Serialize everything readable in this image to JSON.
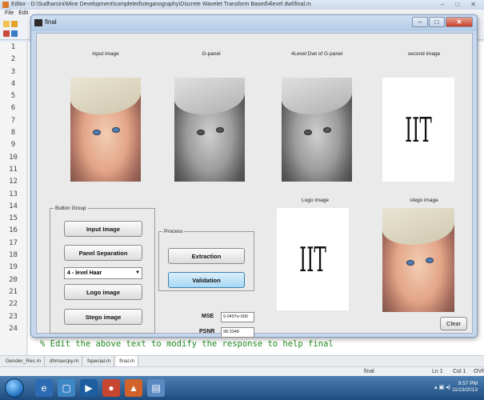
{
  "editor": {
    "title": "Editor - D:\\Sudharsini\\Mine Development\\completed\\steganography\\Discrete Wavelet Transform Based\\4level dwt\\final.m",
    "menu": [
      "File",
      "Edit"
    ],
    "line_numbers": [
      "1",
      "2",
      "3",
      "4",
      "5",
      "6",
      "7",
      "8",
      "9",
      "10",
      "11",
      "12",
      "13",
      "14",
      "15",
      "16",
      "17",
      "18",
      "19",
      "20",
      "21",
      "22",
      "23",
      "24"
    ],
    "code_comment": "% Edit the above text to modify the response to help final",
    "file_tabs": [
      "Gender_Rec.m",
      "dhmaxcpy.m",
      "fspecial.m",
      "final.m"
    ],
    "active_tab": "final.m",
    "status": {
      "name": "final",
      "ln": "Ln 1",
      "col": "Col 1",
      "ovr": "OVR"
    }
  },
  "figure": {
    "title": "final",
    "controls": {
      "minimize": "–",
      "maximize": "□",
      "close": "✕"
    },
    "images": {
      "input": "input image",
      "gpanel": "G-panel",
      "dwt": "4Level Dwt of G-panel",
      "second": "second image",
      "logo": "Logo image",
      "stego": "stego image"
    },
    "logo_text": "IIT",
    "button_group": {
      "legend": "Button Group",
      "input_image": "Input Image",
      "panel_separation": "Panel Separation",
      "level_select": "4 - level Haar",
      "logo_image": "Logo image",
      "stego_image": "Stego image"
    },
    "process": {
      "legend": "Process",
      "extraction": "Extraction",
      "validation": "Validation"
    },
    "metrics": {
      "mse_label": "MSE",
      "mse_value": "9.0497e-006",
      "psnr_label": "PSNR",
      "psnr_value": "98.3348"
    },
    "clear": "Clear"
  },
  "taskbar": {
    "time": "9:57 PM",
    "date": "11/23/2013"
  }
}
